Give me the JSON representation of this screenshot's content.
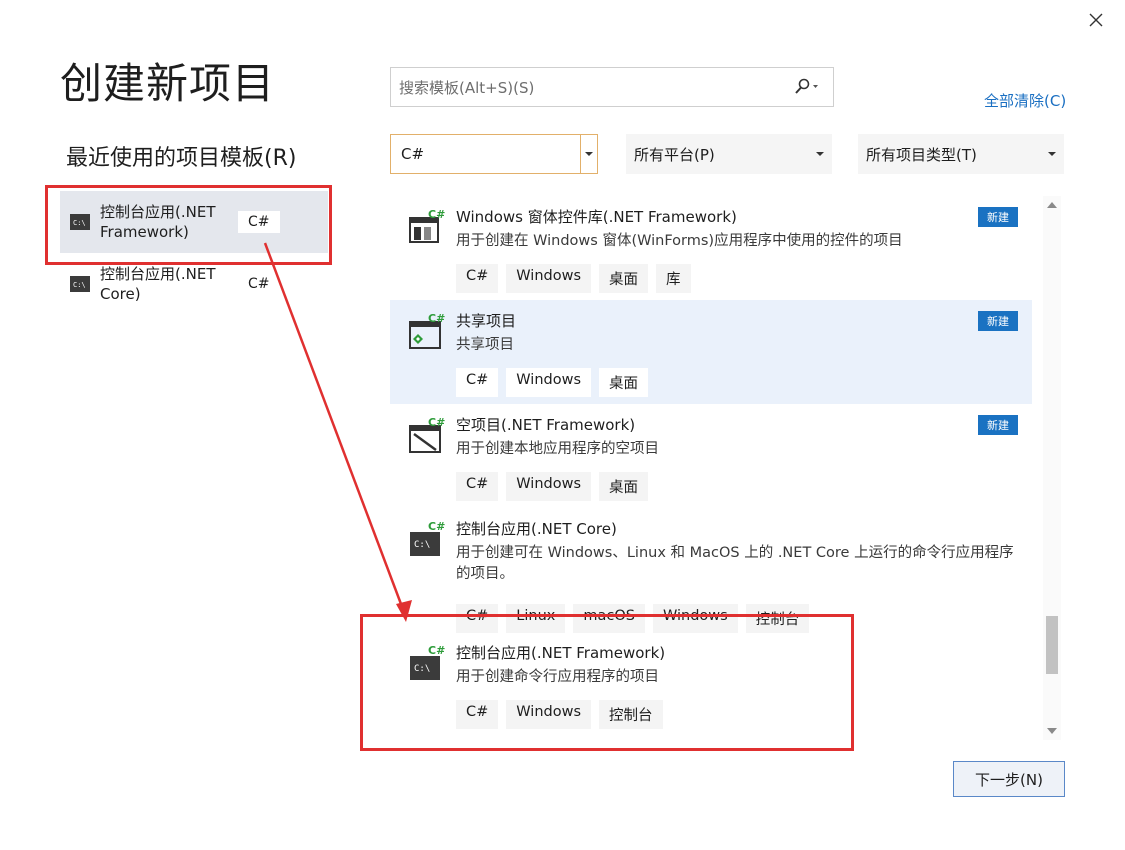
{
  "dialog": {
    "title": "创建新项目",
    "recent_heading": "最近使用的项目模板(R)"
  },
  "recent_templates": [
    {
      "name": "控制台应用(.NET Framework)",
      "tag": "C#",
      "selected": true
    },
    {
      "name": "控制台应用(.NET Core)",
      "tag": "C#",
      "selected": false
    }
  ],
  "search": {
    "placeholder": "搜索模板(Alt+S)(S)",
    "clear_all": "全部清除(C)"
  },
  "filters": {
    "language": "C#",
    "platform": "所有平台(P)",
    "project_type": "所有项目类型(T)"
  },
  "templates": [
    {
      "name": "Windows 窗体控件库(.NET Framework)",
      "description": "用于创建在 Windows 窗体(WinForms)应用程序中使用的控件的项目",
      "tags": [
        "C#",
        "Windows",
        "桌面",
        "库"
      ],
      "badge": "新建",
      "icon": "winforms-control-library-icon"
    },
    {
      "name": "共享项目",
      "description": "共享项目",
      "tags": [
        "C#",
        "Windows",
        "桌面"
      ],
      "badge": "新建",
      "icon": "shared-project-icon"
    },
    {
      "name": "空项目(.NET Framework)",
      "description": "用于创建本地应用程序的空项目",
      "tags": [
        "C#",
        "Windows",
        "桌面"
      ],
      "badge": "新建",
      "icon": "empty-project-icon"
    },
    {
      "name": "控制台应用(.NET Core)",
      "description": "用于创建可在 Windows、Linux 和 MacOS 上的 .NET Core 上运行的命令行应用程序的项目。",
      "tags": [
        "C#",
        "Linux",
        "macOS",
        "Windows",
        "控制台"
      ],
      "badge": "",
      "icon": "console-app-icon"
    },
    {
      "name": "控制台应用(.NET Framework)",
      "description": "用于创建命令行应用程序的项目",
      "tags": [
        "C#",
        "Windows",
        "控制台"
      ],
      "badge": "",
      "icon": "console-app-icon"
    }
  ],
  "buttons": {
    "next": "下一步(N)"
  },
  "colors": {
    "accent": "#1a72c2",
    "annotation": "#e03030",
    "highlight_row": "#eaf1fb"
  }
}
